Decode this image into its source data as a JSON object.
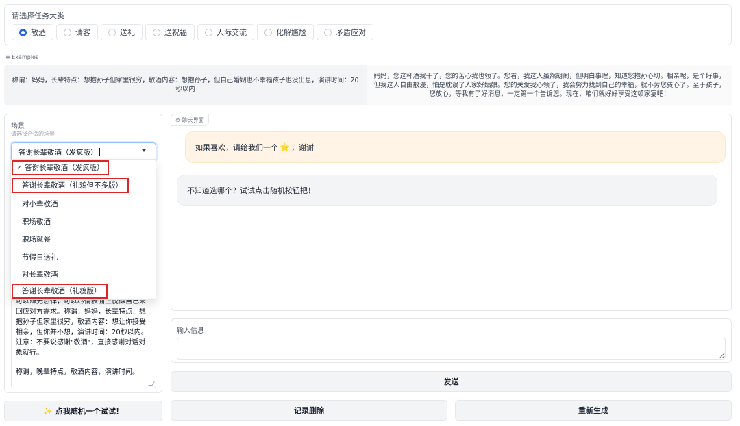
{
  "task": {
    "title": "请选择任务大类",
    "options": [
      "敬酒",
      "请客",
      "送礼",
      "送祝福",
      "人际交流",
      "化解尴尬",
      "矛盾应对"
    ],
    "selected": "敬酒"
  },
  "examples": {
    "label": "Examples",
    "items": [
      "称谓：妈妈，长辈特点：想抱孙子但家里很穷，敬酒内容：想抱孙子，但自己婚姻也不幸福孩子也没出息，演讲时间：20秒以内",
      "妈妈，您这杯酒我干了，您的苦心我也领了。您看，我这人虽然胡闹，但明白事理，知道您抱孙心切。相亲呢，是个好事，但我这人自由散漫，怕是耽误了人家好姑娘。您的关爱我心领了，我会努力找到自己的幸福，就不劳您费心了。至于孩子，您放心，等我有了好消息，一定第一个告诉您。现在，咱们就好好享受这顿家宴吧！"
    ]
  },
  "scene": {
    "title": "场景",
    "subtitle": "请选择合适的场景",
    "selected_value": "答谢长辈敬酒（发疯版）",
    "options": [
      "✓ 答谢长辈敬酒（发疯版）",
      "答谢长辈敬酒（礼貌但不多版）",
      "对小辈敬酒",
      "职场敬酒",
      "职场就餐",
      "节假日送礼",
      "对长辈敬酒",
      "答谢长辈敬酒（礼貌版）"
    ],
    "prompt_text_lines": [
      "可以肆无忌惮，可以尽情表面上貌似自己来",
      "回应对方需求。称谓：妈妈，长辈特点：想",
      "抱孙子但家里很穷，敬酒内容：想让你接受",
      "相亲，但你并不想，演讲时间：20秒以内。",
      "注意：不要说感谢\"敬酒\"，直接感谢对话对",
      "象就行。",
      "",
      "称谓，晚辈特点，敬酒内容，演讲时间。"
    ]
  },
  "random_button": {
    "icon": "magic-wand-icon",
    "label": "点我随机一个试试！"
  },
  "chat": {
    "label": "聊天界面",
    "messages": [
      {
        "role": "bot",
        "text_before": "如果喜欢，请给我们一个",
        "emoji": "⭐",
        "text_after": "，谢谢"
      },
      {
        "role": "user",
        "text": "不知道选哪个？试试点击随机按钮把！"
      }
    ]
  },
  "input": {
    "label": "输入信息",
    "placeholder": ""
  },
  "buttons": {
    "send": "发送",
    "clear": "记录删除",
    "regenerate": "重新生成"
  },
  "colors": {
    "accent": "#2563eb",
    "highlight_box": "#dc2626",
    "bot_bubble": "#fff4e6"
  }
}
